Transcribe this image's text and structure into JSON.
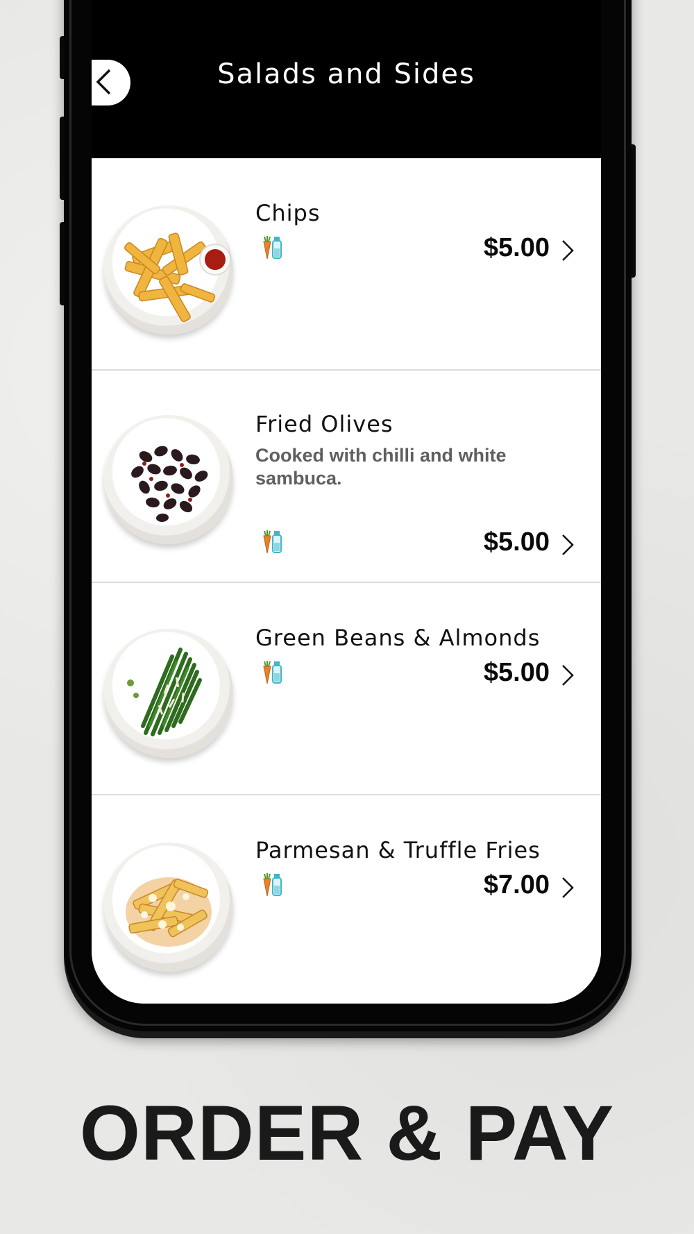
{
  "header": {
    "title": "Salads and Sides"
  },
  "menu_items": [
    {
      "name": "Chips",
      "description": "",
      "price": "$5.00",
      "dietary": "vegetarian-vegan-icon"
    },
    {
      "name": "Fried Olives",
      "description": "Cooked with chilli and white sambuca.",
      "price": "$5.00",
      "dietary": "vegetarian-vegan-icon"
    },
    {
      "name": "Green Beans & Almonds",
      "description": "",
      "price": "$5.00",
      "dietary": "vegetarian-vegan-icon"
    },
    {
      "name": "Parmesan & Truffle Fries",
      "description": "",
      "price": "$7.00",
      "dietary": "vegetarian-vegan-icon"
    }
  ],
  "tagline": "ORDER & PAY",
  "colors": {
    "header_bg": "#000000",
    "screen_bg": "#ffffff",
    "carrot": "#e8832a",
    "bottle": "#3fb6c9"
  }
}
